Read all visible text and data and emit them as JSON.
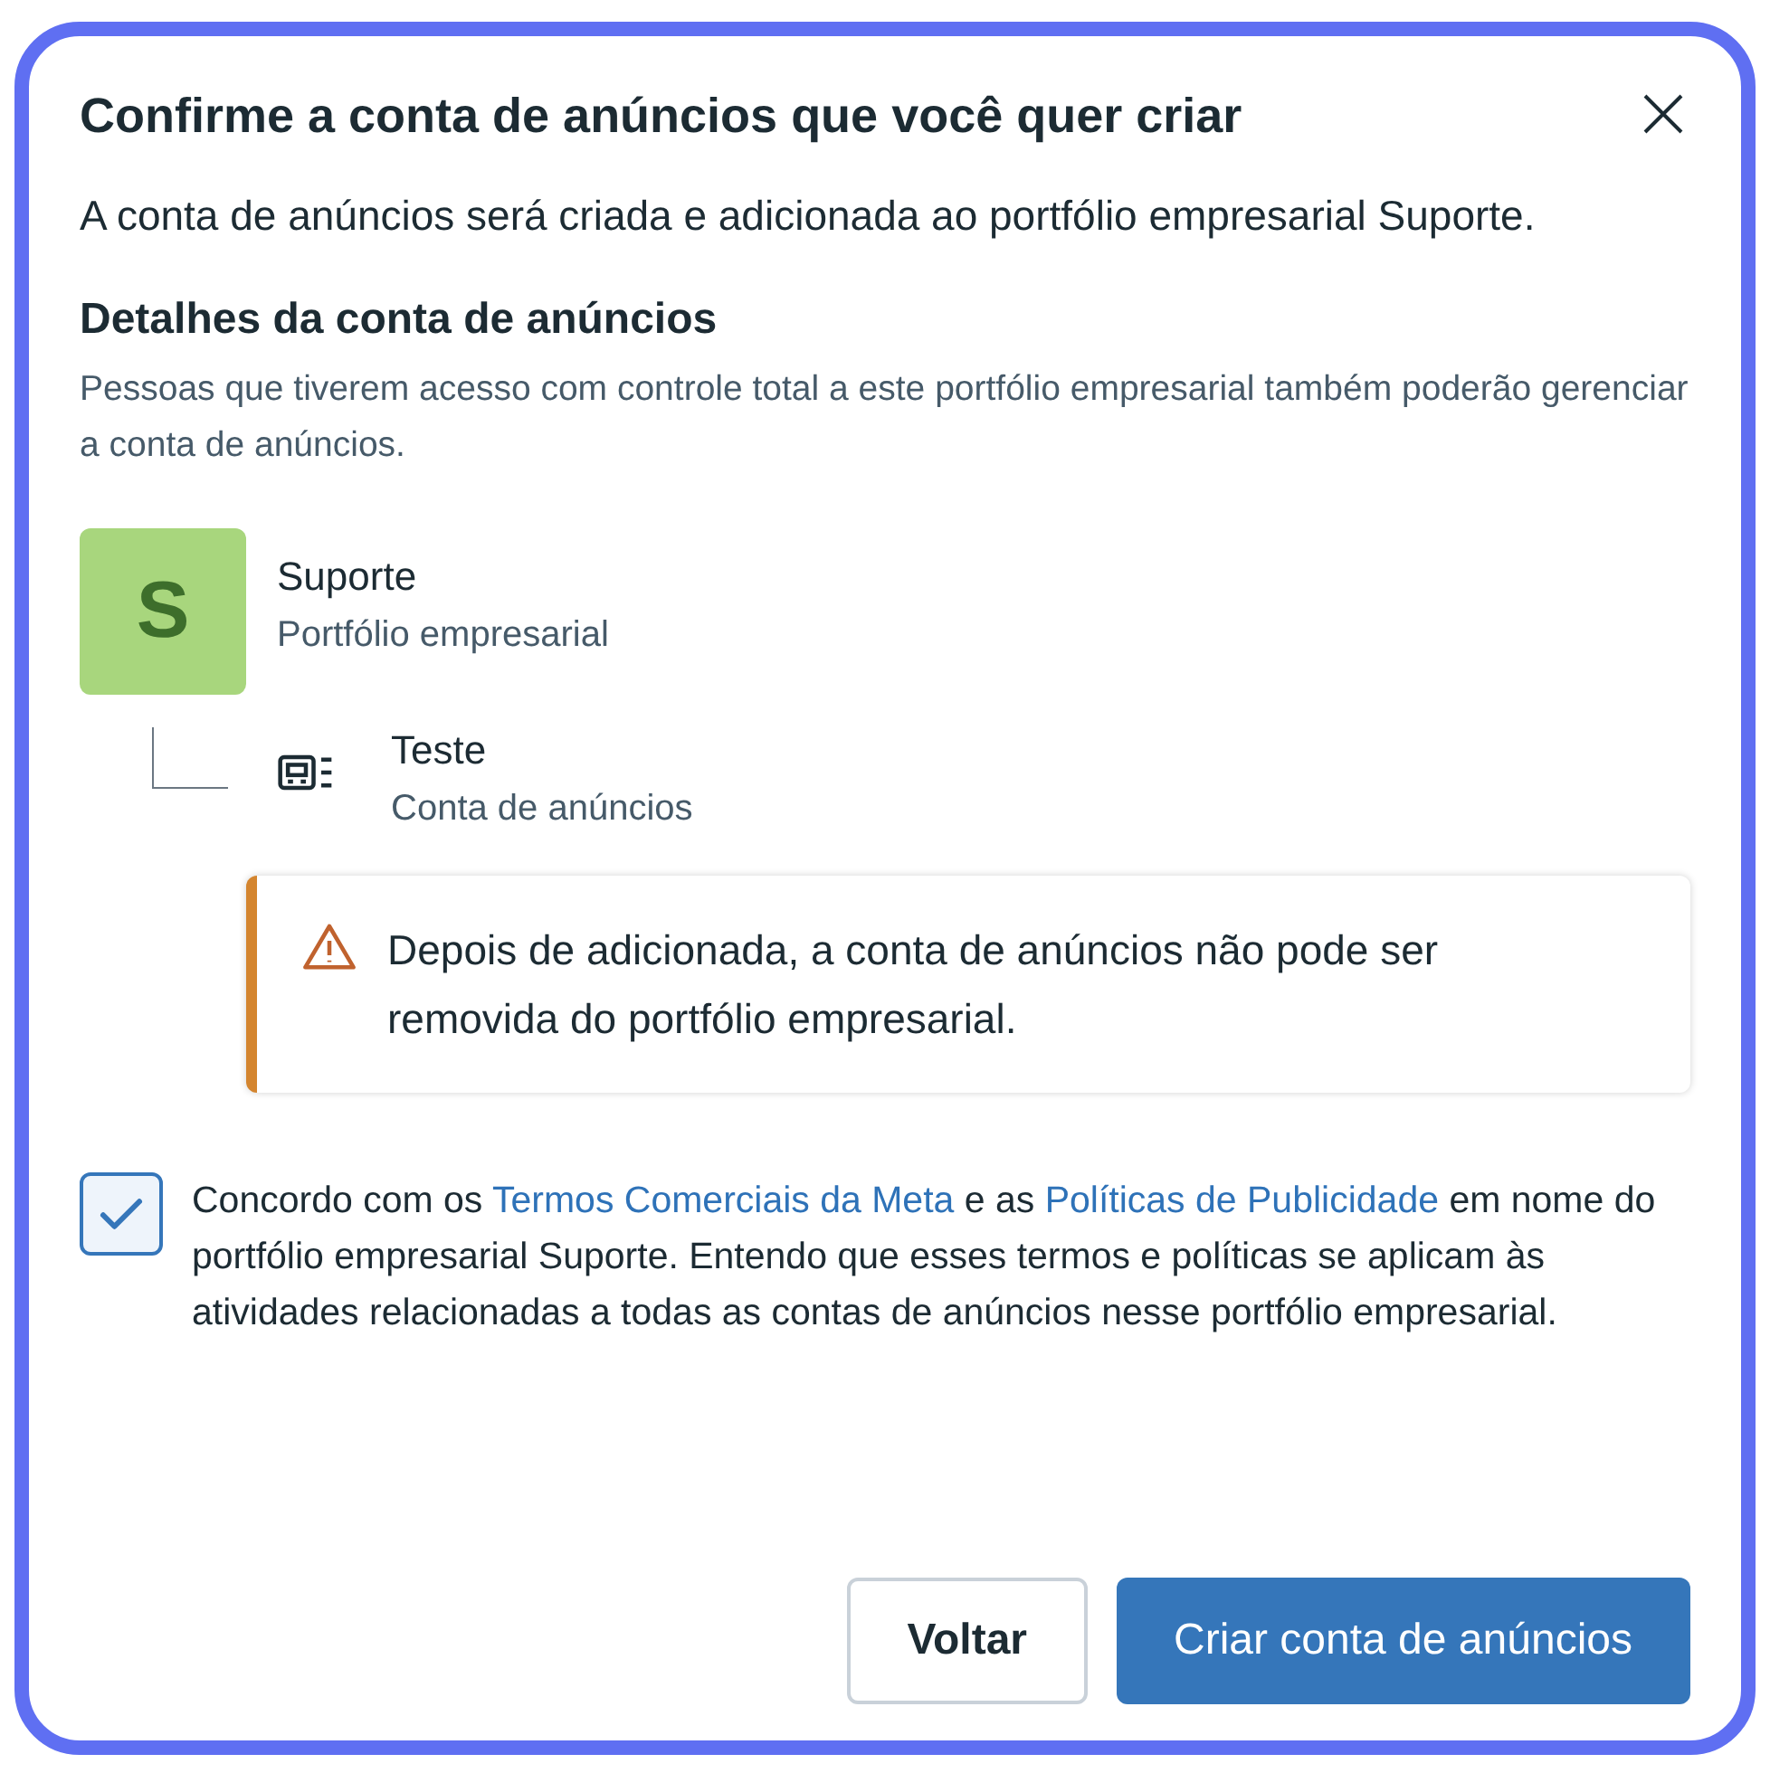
{
  "dialog": {
    "title": "Confirme a conta de anúncios que você quer criar",
    "intro": "A conta de anúncios será criada e adicionada ao portfólio empresarial Suporte.",
    "section_title": "Detalhes da conta de anúncios",
    "section_description": "Pessoas que tiverem acesso com controle total a este portfólio empresarial também poderão gerenciar a conta de anúncios.",
    "portfolio": {
      "avatar_letter": "S",
      "name": "Suporte",
      "type": "Portfólio empresarial",
      "children": [
        {
          "name": "Teste",
          "type": "Conta de anúncios"
        }
      ]
    },
    "warning": {
      "text": "Depois de adicionada, a conta de anúncios não pode ser removida do portfólio empresarial."
    },
    "consent": {
      "checked": true,
      "parts": [
        {
          "kind": "text",
          "text": "Concordo com os "
        },
        {
          "kind": "link",
          "text": "Termos Comerciais da Meta"
        },
        {
          "kind": "text",
          "text": " e as "
        },
        {
          "kind": "link",
          "text": "Políticas de Publicidade"
        },
        {
          "kind": "text",
          "text": " em nome do portfólio empresarial Suporte. Entendo que esses termos e políticas se aplicam às atividades relacionadas a todas as contas de anúncios nesse portfólio empresarial."
        }
      ]
    },
    "buttons": [
      {
        "kind": "secondary",
        "label": "Voltar"
      },
      {
        "kind": "primary",
        "label": "Criar conta de anúncios"
      }
    ]
  }
}
